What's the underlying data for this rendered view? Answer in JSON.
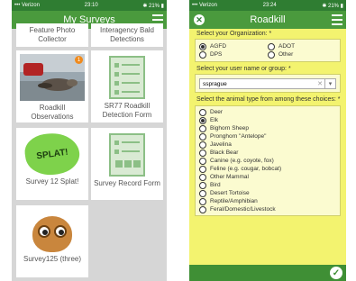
{
  "left_phone": {
    "status": {
      "carrier": "••• Verizon",
      "time": "23:10",
      "battery": "✱ 21% ▮"
    },
    "title": "My Surveys",
    "tiles": [
      {
        "label": "Feature Photo Collector"
      },
      {
        "label": "Interagency Bald Detections"
      },
      {
        "label": "Roadkill Observations",
        "badge": "1"
      },
      {
        "label": "SR77 Roadkill Detection Form"
      },
      {
        "label": "Survey 12 Splat!",
        "splat_text": "SPLAT!"
      },
      {
        "label": "Survey Record Form"
      },
      {
        "label": "Survey125 (three)"
      }
    ]
  },
  "right_phone": {
    "status": {
      "carrier": "••• Verizon",
      "time": "23:24",
      "battery": "✱ 21% ▮"
    },
    "title": "Roadkill",
    "org_question": "Select your Organization: *",
    "org_options": [
      {
        "label": "AGFD",
        "selected": true
      },
      {
        "label": "ADOT",
        "selected": false
      },
      {
        "label": "DPS",
        "selected": false
      },
      {
        "label": "Other",
        "selected": false
      }
    ],
    "user_question": "Select your user name or group: *",
    "user_value": "ssprague",
    "animal_question": "Select the animal type from among these choices: *",
    "animal_options": [
      {
        "label": "Deer",
        "selected": false
      },
      {
        "label": "Elk",
        "selected": true
      },
      {
        "label": "Bighorn Sheep",
        "selected": false
      },
      {
        "label": "Pronghorn \"Antelope\"",
        "selected": false
      },
      {
        "label": "Javelina",
        "selected": false
      },
      {
        "label": "Black Bear",
        "selected": false
      },
      {
        "label": "Canine (e.g. coyote, fox)",
        "selected": false
      },
      {
        "label": "Feline (e.g. cougar, bobcat)",
        "selected": false
      },
      {
        "label": "Other Mammal",
        "selected": false
      },
      {
        "label": "Bird",
        "selected": false
      },
      {
        "label": "Desert Tortoise",
        "selected": false
      },
      {
        "label": "Reptile/Amphibian",
        "selected": false
      },
      {
        "label": "Feral/Domestic/Livestock",
        "selected": false
      }
    ],
    "accent": "#4a9a3d",
    "form_bg": "#f3f36f"
  }
}
